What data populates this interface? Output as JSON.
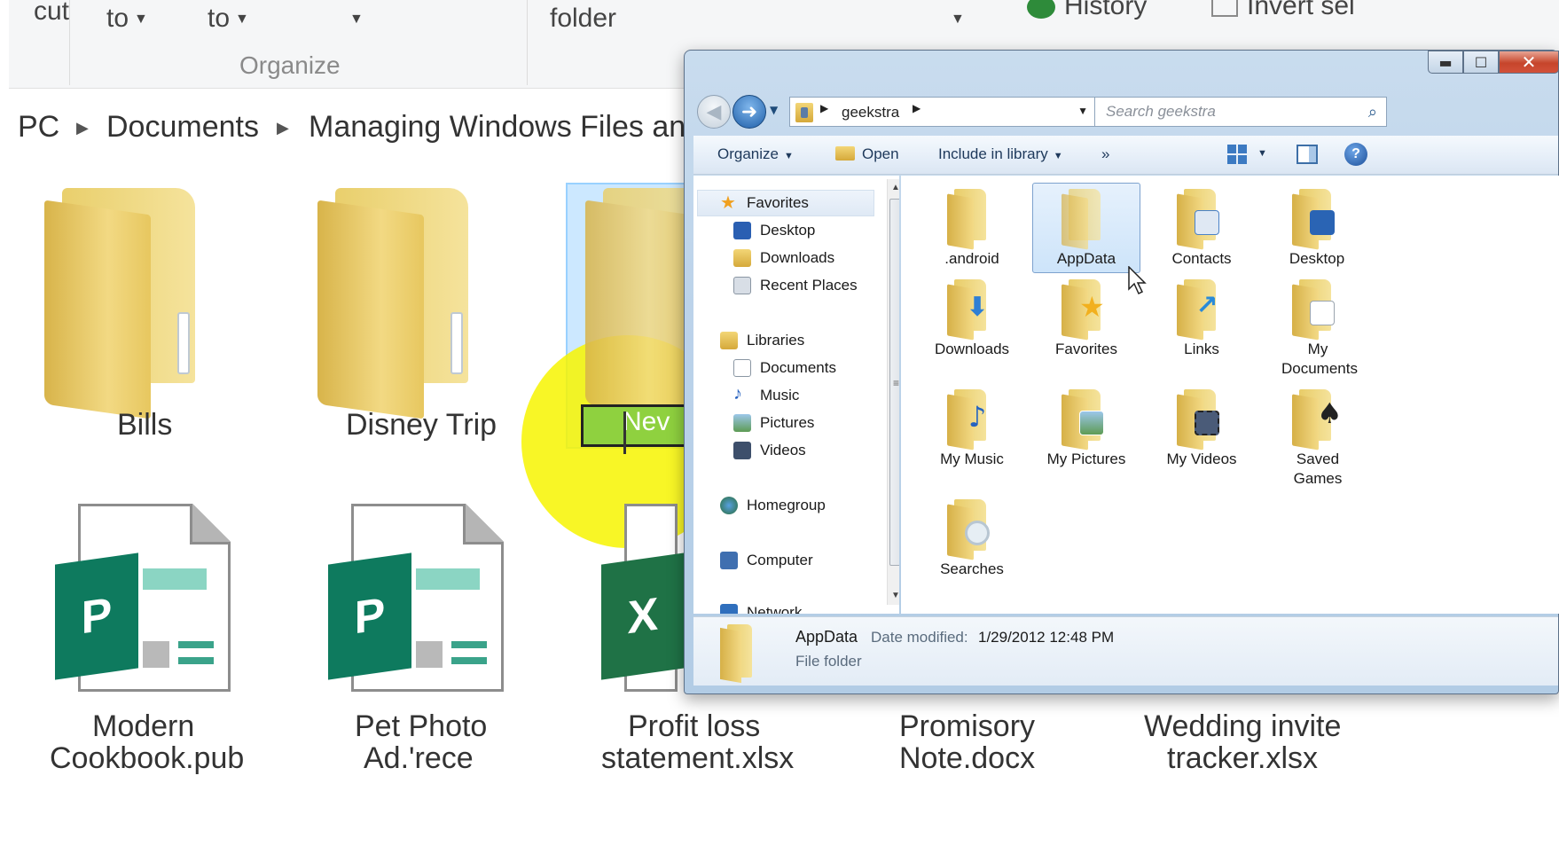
{
  "background": {
    "ribbon": {
      "items": [
        "cut",
        "to",
        "to",
        "folder",
        "History",
        "Invert sel"
      ],
      "group_label": "Organize"
    },
    "breadcrumb": [
      "PC",
      "Documents",
      "Managing Windows Files and"
    ],
    "folders": [
      "Bills",
      "Disney Trip"
    ],
    "rename_text": "Nev",
    "files": [
      {
        "name_line1": "Modern",
        "name_line2": "Cookbook.pub",
        "badge": "P"
      },
      {
        "name_line1": "Pet Photo",
        "name_line2": "Ad.'rece",
        "badge": "P"
      },
      {
        "name_line1": "Profit loss",
        "name_line2": "statement.xlsx",
        "badge": "X"
      }
    ],
    "cut_off_labels": [
      {
        "line1": "Promisory",
        "line2": "Note.docx"
      },
      {
        "line1": "Wedding invite",
        "line2": "tracker.xlsx"
      }
    ],
    "colors": {
      "highlight": "#f7f500",
      "publisher": "#0e7a5e",
      "excel": "#1f7246"
    }
  },
  "window": {
    "caption": {
      "minimize": "▬",
      "maximize": "☐",
      "close": "✕"
    },
    "address": {
      "path": "geekstra",
      "search_placeholder": "Search geekstra"
    },
    "toolbar": {
      "organize": "Organize",
      "open": "Open",
      "include": "Include in library",
      "more": "»",
      "help": "?"
    },
    "nav": {
      "favorites": "Favorites",
      "desktop": "Desktop",
      "downloads": "Downloads",
      "recent": "Recent Places",
      "libraries": "Libraries",
      "documents": "Documents",
      "music": "Music",
      "pictures": "Pictures",
      "videos": "Videos",
      "homegroup": "Homegroup",
      "computer": "Computer",
      "network": "Network"
    },
    "items": [
      {
        "name": ".android",
        "overlay": "none"
      },
      {
        "name": "AppData",
        "overlay": "none",
        "selected": true
      },
      {
        "name": "Contacts",
        "overlay": "#4a82c8"
      },
      {
        "name": "Desktop",
        "overlay": "#2a64b4"
      },
      {
        "name": "Downloads",
        "overlay": "#2f7fd4"
      },
      {
        "name": "Favorites",
        "overlay": "#f2b01e"
      },
      {
        "name": "Links",
        "overlay": "#2a8ad8"
      },
      {
        "name": "My Documents",
        "overlay": "#ffffff"
      },
      {
        "name": "My Music",
        "overlay": "#2563c0"
      },
      {
        "name": "My Pictures",
        "overlay": "#5d9b54"
      },
      {
        "name": "My Videos",
        "overlay": "#4a5b78"
      },
      {
        "name": "Saved Games",
        "overlay": "#222222"
      },
      {
        "name": "Searches",
        "overlay": "#cfd8e0"
      }
    ],
    "details": {
      "name": "AppData",
      "date_label": "Date modified:",
      "date_value": "1/29/2012 12:48 PM",
      "type": "File folder"
    }
  }
}
